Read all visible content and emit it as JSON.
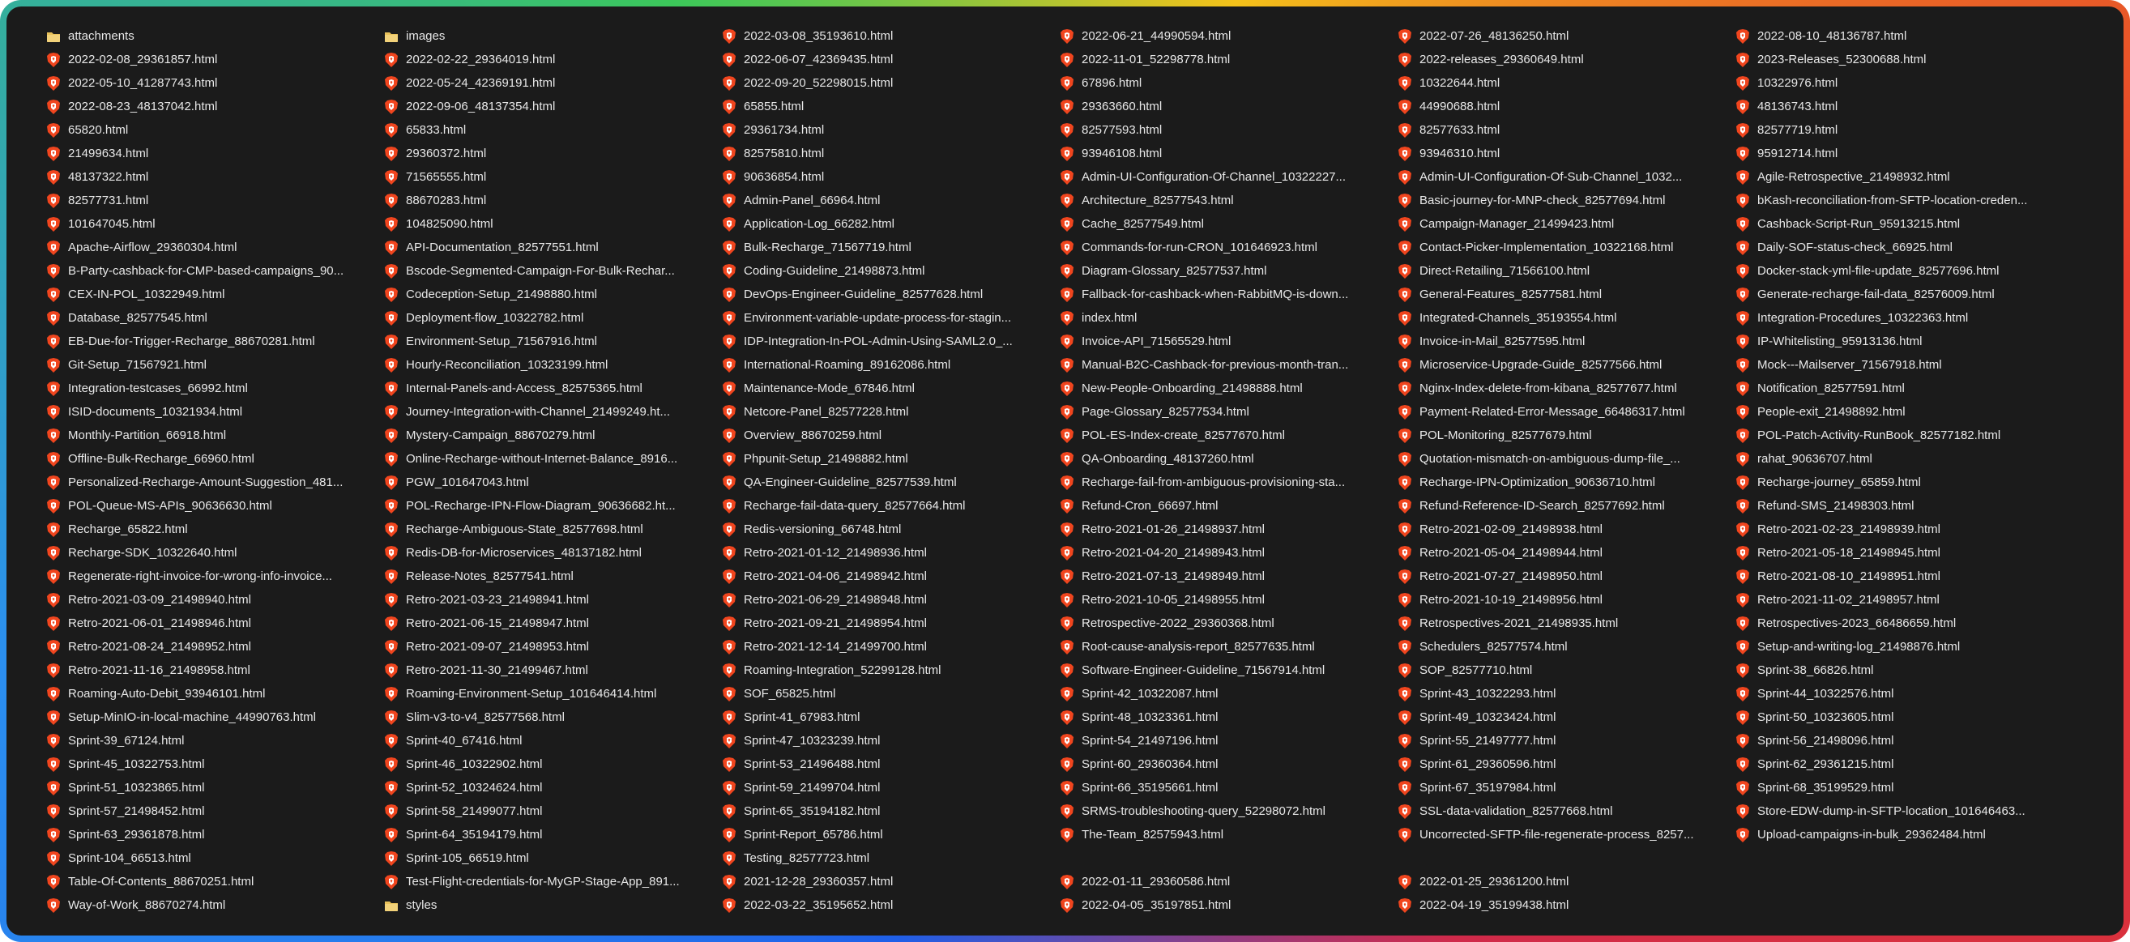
{
  "files": [
    {
      "name": "attachments",
      "type": "folder"
    },
    {
      "name": "2022-02-08_29361857.html",
      "type": "html"
    },
    {
      "name": "2022-05-10_41287743.html",
      "type": "html"
    },
    {
      "name": "2022-08-23_48137042.html",
      "type": "html"
    },
    {
      "name": "65820.html",
      "type": "html"
    },
    {
      "name": "21499634.html",
      "type": "html"
    },
    {
      "name": "48137322.html",
      "type": "html"
    },
    {
      "name": "82577731.html",
      "type": "html"
    },
    {
      "name": "101647045.html",
      "type": "html"
    },
    {
      "name": "Apache-Airflow_29360304.html",
      "type": "html"
    },
    {
      "name": "B-Party-cashback-for-CMP-based-campaigns_90...",
      "type": "html"
    },
    {
      "name": "CEX-IN-POL_10322949.html",
      "type": "html"
    },
    {
      "name": "Database_82577545.html",
      "type": "html"
    },
    {
      "name": "EB-Due-for-Trigger-Recharge_88670281.html",
      "type": "html"
    },
    {
      "name": "Git-Setup_71567921.html",
      "type": "html"
    },
    {
      "name": "Integration-testcases_66992.html",
      "type": "html"
    },
    {
      "name": "ISID-documents_10321934.html",
      "type": "html"
    },
    {
      "name": "Monthly-Partition_66918.html",
      "type": "html"
    },
    {
      "name": "Offline-Bulk-Recharge_66960.html",
      "type": "html"
    },
    {
      "name": "Personalized-Recharge-Amount-Suggestion_481...",
      "type": "html"
    },
    {
      "name": "POL-Queue-MS-APIs_90636630.html",
      "type": "html"
    },
    {
      "name": "Recharge_65822.html",
      "type": "html"
    },
    {
      "name": "Recharge-SDK_10322640.html",
      "type": "html"
    },
    {
      "name": "Regenerate-right-invoice-for-wrong-info-invoice...",
      "type": "html"
    },
    {
      "name": "Retro-2021-03-09_21498940.html",
      "type": "html"
    },
    {
      "name": "Retro-2021-06-01_21498946.html",
      "type": "html"
    },
    {
      "name": "Retro-2021-08-24_21498952.html",
      "type": "html"
    },
    {
      "name": "Retro-2021-11-16_21498958.html",
      "type": "html"
    },
    {
      "name": "Roaming-Auto-Debit_93946101.html",
      "type": "html"
    },
    {
      "name": "Setup-MinIO-in-local-machine_44990763.html",
      "type": "html"
    },
    {
      "name": "Sprint-39_67124.html",
      "type": "html"
    },
    {
      "name": "Sprint-45_10322753.html",
      "type": "html"
    },
    {
      "name": "Sprint-51_10323865.html",
      "type": "html"
    },
    {
      "name": "Sprint-57_21498452.html",
      "type": "html"
    },
    {
      "name": "Sprint-63_29361878.html",
      "type": "html"
    },
    {
      "name": "Sprint-104_66513.html",
      "type": "html"
    },
    {
      "name": "Table-Of-Contents_88670251.html",
      "type": "html"
    },
    {
      "name": "Way-of-Work_88670274.html",
      "type": "html"
    },
    {
      "name": "images",
      "type": "folder"
    },
    {
      "name": "2022-02-22_29364019.html",
      "type": "html"
    },
    {
      "name": "2022-05-24_42369191.html",
      "type": "html"
    },
    {
      "name": "2022-09-06_48137354.html",
      "type": "html"
    },
    {
      "name": "65833.html",
      "type": "html"
    },
    {
      "name": "29360372.html",
      "type": "html"
    },
    {
      "name": "71565555.html",
      "type": "html"
    },
    {
      "name": "88670283.html",
      "type": "html"
    },
    {
      "name": "104825090.html",
      "type": "html"
    },
    {
      "name": "API-Documentation_82577551.html",
      "type": "html"
    },
    {
      "name": "Bscode-Segmented-Campaign-For-Bulk-Rechar...",
      "type": "html"
    },
    {
      "name": "Codeception-Setup_21498880.html",
      "type": "html"
    },
    {
      "name": "Deployment-flow_10322782.html",
      "type": "html"
    },
    {
      "name": "Environment-Setup_71567916.html",
      "type": "html"
    },
    {
      "name": "Hourly-Reconciliation_10323199.html",
      "type": "html"
    },
    {
      "name": "Internal-Panels-and-Access_82575365.html",
      "type": "html"
    },
    {
      "name": "Journey-Integration-with-Channel_21499249.ht...",
      "type": "html"
    },
    {
      "name": "Mystery-Campaign_88670279.html",
      "type": "html"
    },
    {
      "name": "Online-Recharge-without-Internet-Balance_8916...",
      "type": "html"
    },
    {
      "name": "PGW_101647043.html",
      "type": "html"
    },
    {
      "name": "POL-Recharge-IPN-Flow-Diagram_90636682.ht...",
      "type": "html"
    },
    {
      "name": "Recharge-Ambiguous-State_82577698.html",
      "type": "html"
    },
    {
      "name": "Redis-DB-for-Microservices_48137182.html",
      "type": "html"
    },
    {
      "name": "Release-Notes_82577541.html",
      "type": "html"
    },
    {
      "name": "Retro-2021-03-23_21498941.html",
      "type": "html"
    },
    {
      "name": "Retro-2021-06-15_21498947.html",
      "type": "html"
    },
    {
      "name": "Retro-2021-09-07_21498953.html",
      "type": "html"
    },
    {
      "name": "Retro-2021-11-30_21499467.html",
      "type": "html"
    },
    {
      "name": "Roaming-Environment-Setup_101646414.html",
      "type": "html"
    },
    {
      "name": "Slim-v3-to-v4_82577568.html",
      "type": "html"
    },
    {
      "name": "Sprint-40_67416.html",
      "type": "html"
    },
    {
      "name": "Sprint-46_10322902.html",
      "type": "html"
    },
    {
      "name": "Sprint-52_10324624.html",
      "type": "html"
    },
    {
      "name": "Sprint-58_21499077.html",
      "type": "html"
    },
    {
      "name": "Sprint-64_35194179.html",
      "type": "html"
    },
    {
      "name": "Sprint-105_66519.html",
      "type": "html"
    },
    {
      "name": "Test-Flight-credentials-for-MyGP-Stage-App_891...",
      "type": "html"
    },
    {
      "name": "styles",
      "type": "folder"
    },
    {
      "name": "2022-03-08_35193610.html",
      "type": "html"
    },
    {
      "name": "2022-06-07_42369435.html",
      "type": "html"
    },
    {
      "name": "2022-09-20_52298015.html",
      "type": "html"
    },
    {
      "name": "65855.html",
      "type": "html"
    },
    {
      "name": "29361734.html",
      "type": "html"
    },
    {
      "name": "82575810.html",
      "type": "html"
    },
    {
      "name": "90636854.html",
      "type": "html"
    },
    {
      "name": "Admin-Panel_66964.html",
      "type": "html"
    },
    {
      "name": "Application-Log_66282.html",
      "type": "html"
    },
    {
      "name": "Bulk-Recharge_71567719.html",
      "type": "html"
    },
    {
      "name": "Coding-Guideline_21498873.html",
      "type": "html"
    },
    {
      "name": "DevOps-Engineer-Guideline_82577628.html",
      "type": "html"
    },
    {
      "name": "Environment-variable-update-process-for-stagin...",
      "type": "html"
    },
    {
      "name": "IDP-Integration-In-POL-Admin-Using-SAML2.0_...",
      "type": "html"
    },
    {
      "name": "International-Roaming_89162086.html",
      "type": "html"
    },
    {
      "name": "Maintenance-Mode_67846.html",
      "type": "html"
    },
    {
      "name": "Netcore-Panel_82577228.html",
      "type": "html"
    },
    {
      "name": "Overview_88670259.html",
      "type": "html"
    },
    {
      "name": "Phpunit-Setup_21498882.html",
      "type": "html"
    },
    {
      "name": "QA-Engineer-Guideline_82577539.html",
      "type": "html"
    },
    {
      "name": "Recharge-fail-data-query_82577664.html",
      "type": "html"
    },
    {
      "name": "Redis-versioning_66748.html",
      "type": "html"
    },
    {
      "name": "Retro-2021-01-12_21498936.html",
      "type": "html"
    },
    {
      "name": "Retro-2021-04-06_21498942.html",
      "type": "html"
    },
    {
      "name": "Retro-2021-06-29_21498948.html",
      "type": "html"
    },
    {
      "name": "Retro-2021-09-21_21498954.html",
      "type": "html"
    },
    {
      "name": "Retro-2021-12-14_21499700.html",
      "type": "html"
    },
    {
      "name": "Roaming-Integration_52299128.html",
      "type": "html"
    },
    {
      "name": "SOF_65825.html",
      "type": "html"
    },
    {
      "name": "Sprint-41_67983.html",
      "type": "html"
    },
    {
      "name": "Sprint-47_10323239.html",
      "type": "html"
    },
    {
      "name": "Sprint-53_21496488.html",
      "type": "html"
    },
    {
      "name": "Sprint-59_21499704.html",
      "type": "html"
    },
    {
      "name": "Sprint-65_35194182.html",
      "type": "html"
    },
    {
      "name": "Sprint-Report_65786.html",
      "type": "html"
    },
    {
      "name": "Testing_82577723.html",
      "type": "html"
    },
    {
      "name": "2021-12-28_29360357.html",
      "type": "html"
    },
    {
      "name": "2022-03-22_35195652.html",
      "type": "html"
    },
    {
      "name": "2022-06-21_44990594.html",
      "type": "html"
    },
    {
      "name": "2022-11-01_52298778.html",
      "type": "html"
    },
    {
      "name": "67896.html",
      "type": "html"
    },
    {
      "name": "29363660.html",
      "type": "html"
    },
    {
      "name": "82577593.html",
      "type": "html"
    },
    {
      "name": "93946108.html",
      "type": "html"
    },
    {
      "name": "Admin-UI-Configuration-Of-Channel_10322227...",
      "type": "html"
    },
    {
      "name": "Architecture_82577543.html",
      "type": "html"
    },
    {
      "name": "Cache_82577549.html",
      "type": "html"
    },
    {
      "name": "Commands-for-run-CRON_101646923.html",
      "type": "html"
    },
    {
      "name": "Diagram-Glossary_82577537.html",
      "type": "html"
    },
    {
      "name": "Fallback-for-cashback-when-RabbitMQ-is-down...",
      "type": "html"
    },
    {
      "name": "index.html",
      "type": "html"
    },
    {
      "name": "Invoice-API_71565529.html",
      "type": "html"
    },
    {
      "name": "Manual-B2C-Cashback-for-previous-month-tran...",
      "type": "html"
    },
    {
      "name": "New-People-Onboarding_21498888.html",
      "type": "html"
    },
    {
      "name": "Page-Glossary_82577534.html",
      "type": "html"
    },
    {
      "name": "POL-ES-Index-create_82577670.html",
      "type": "html"
    },
    {
      "name": "QA-Onboarding_48137260.html",
      "type": "html"
    },
    {
      "name": "Recharge-fail-from-ambiguous-provisioning-sta...",
      "type": "html"
    },
    {
      "name": "Refund-Cron_66697.html",
      "type": "html"
    },
    {
      "name": "Retro-2021-01-26_21498937.html",
      "type": "html"
    },
    {
      "name": "Retro-2021-04-20_21498943.html",
      "type": "html"
    },
    {
      "name": "Retro-2021-07-13_21498949.html",
      "type": "html"
    },
    {
      "name": "Retro-2021-10-05_21498955.html",
      "type": "html"
    },
    {
      "name": "Retrospective-2022_29360368.html",
      "type": "html"
    },
    {
      "name": "Root-cause-analysis-report_82577635.html",
      "type": "html"
    },
    {
      "name": "Software-Engineer-Guideline_71567914.html",
      "type": "html"
    },
    {
      "name": "Sprint-42_10322087.html",
      "type": "html"
    },
    {
      "name": "Sprint-48_10323361.html",
      "type": "html"
    },
    {
      "name": "Sprint-54_21497196.html",
      "type": "html"
    },
    {
      "name": "Sprint-60_29360364.html",
      "type": "html"
    },
    {
      "name": "Sprint-66_35195661.html",
      "type": "html"
    },
    {
      "name": "SRMS-troubleshooting-query_52298072.html",
      "type": "html"
    },
    {
      "name": "The-Team_82575943.html",
      "type": "html"
    },
    {
      "name": "",
      "type": "empty"
    },
    {
      "name": "2022-01-11_29360586.html",
      "type": "html"
    },
    {
      "name": "2022-04-05_35197851.html",
      "type": "html"
    },
    {
      "name": "2022-07-26_48136250.html",
      "type": "html"
    },
    {
      "name": "2022-releases_29360649.html",
      "type": "html"
    },
    {
      "name": "10322644.html",
      "type": "html"
    },
    {
      "name": "44990688.html",
      "type": "html"
    },
    {
      "name": "82577633.html",
      "type": "html"
    },
    {
      "name": "93946310.html",
      "type": "html"
    },
    {
      "name": "Admin-UI-Configuration-Of-Sub-Channel_1032...",
      "type": "html"
    },
    {
      "name": "Basic-journey-for-MNP-check_82577694.html",
      "type": "html"
    },
    {
      "name": "Campaign-Manager_21499423.html",
      "type": "html"
    },
    {
      "name": "Contact-Picker-Implementation_10322168.html",
      "type": "html"
    },
    {
      "name": "Direct-Retailing_71566100.html",
      "type": "html"
    },
    {
      "name": "General-Features_82577581.html",
      "type": "html"
    },
    {
      "name": "Integrated-Channels_35193554.html",
      "type": "html"
    },
    {
      "name": "Invoice-in-Mail_82577595.html",
      "type": "html"
    },
    {
      "name": "Microservice-Upgrade-Guide_82577566.html",
      "type": "html"
    },
    {
      "name": "Nginx-Index-delete-from-kibana_82577677.html",
      "type": "html"
    },
    {
      "name": "Payment-Related-Error-Message_66486317.html",
      "type": "html"
    },
    {
      "name": "POL-Monitoring_82577679.html",
      "type": "html"
    },
    {
      "name": "Quotation-mismatch-on-ambiguous-dump-file_...",
      "type": "html"
    },
    {
      "name": "Recharge-IPN-Optimization_90636710.html",
      "type": "html"
    },
    {
      "name": "Refund-Reference-ID-Search_82577692.html",
      "type": "html"
    },
    {
      "name": "Retro-2021-02-09_21498938.html",
      "type": "html"
    },
    {
      "name": "Retro-2021-05-04_21498944.html",
      "type": "html"
    },
    {
      "name": "Retro-2021-07-27_21498950.html",
      "type": "html"
    },
    {
      "name": "Retro-2021-10-19_21498956.html",
      "type": "html"
    },
    {
      "name": "Retrospectives-2021_21498935.html",
      "type": "html"
    },
    {
      "name": "Schedulers_82577574.html",
      "type": "html"
    },
    {
      "name": "SOP_82577710.html",
      "type": "html"
    },
    {
      "name": "Sprint-43_10322293.html",
      "type": "html"
    },
    {
      "name": "Sprint-49_10323424.html",
      "type": "html"
    },
    {
      "name": "Sprint-55_21497777.html",
      "type": "html"
    },
    {
      "name": "Sprint-61_29360596.html",
      "type": "html"
    },
    {
      "name": "Sprint-67_35197984.html",
      "type": "html"
    },
    {
      "name": "SSL-data-validation_82577668.html",
      "type": "html"
    },
    {
      "name": "Uncorrected-SFTP-file-regenerate-process_8257...",
      "type": "html"
    },
    {
      "name": "",
      "type": "empty"
    },
    {
      "name": "2022-01-25_29361200.html",
      "type": "html"
    },
    {
      "name": "2022-04-19_35199438.html",
      "type": "html"
    },
    {
      "name": "2022-08-10_48136787.html",
      "type": "html"
    },
    {
      "name": "2023-Releases_52300688.html",
      "type": "html"
    },
    {
      "name": "10322976.html",
      "type": "html"
    },
    {
      "name": "48136743.html",
      "type": "html"
    },
    {
      "name": "82577719.html",
      "type": "html"
    },
    {
      "name": "95912714.html",
      "type": "html"
    },
    {
      "name": "Agile-Retrospective_21498932.html",
      "type": "html"
    },
    {
      "name": "bKash-reconciliation-from-SFTP-location-creden...",
      "type": "html"
    },
    {
      "name": "Cashback-Script-Run_95913215.html",
      "type": "html"
    },
    {
      "name": "Daily-SOF-status-check_66925.html",
      "type": "html"
    },
    {
      "name": "Docker-stack-yml-file-update_82577696.html",
      "type": "html"
    },
    {
      "name": "Generate-recharge-fail-data_82576009.html",
      "type": "html"
    },
    {
      "name": "Integration-Procedures_10322363.html",
      "type": "html"
    },
    {
      "name": "IP-Whitelisting_95913136.html",
      "type": "html"
    },
    {
      "name": "Mock---Mailserver_71567918.html",
      "type": "html"
    },
    {
      "name": "Notification_82577591.html",
      "type": "html"
    },
    {
      "name": "People-exit_21498892.html",
      "type": "html"
    },
    {
      "name": "POL-Patch-Activity-RunBook_82577182.html",
      "type": "html"
    },
    {
      "name": "rahat_90636707.html",
      "type": "html"
    },
    {
      "name": "Recharge-journey_65859.html",
      "type": "html"
    },
    {
      "name": "Refund-SMS_21498303.html",
      "type": "html"
    },
    {
      "name": "Retro-2021-02-23_21498939.html",
      "type": "html"
    },
    {
      "name": "Retro-2021-05-18_21498945.html",
      "type": "html"
    },
    {
      "name": "Retro-2021-08-10_21498951.html",
      "type": "html"
    },
    {
      "name": "Retro-2021-11-02_21498957.html",
      "type": "html"
    },
    {
      "name": "Retrospectives-2023_66486659.html",
      "type": "html"
    },
    {
      "name": "Setup-and-writing-log_21498876.html",
      "type": "html"
    },
    {
      "name": "Sprint-38_66826.html",
      "type": "html"
    },
    {
      "name": "Sprint-44_10322576.html",
      "type": "html"
    },
    {
      "name": "Sprint-50_10323605.html",
      "type": "html"
    },
    {
      "name": "Sprint-56_21498096.html",
      "type": "html"
    },
    {
      "name": "Sprint-62_29361215.html",
      "type": "html"
    },
    {
      "name": "Sprint-68_35199529.html",
      "type": "html"
    },
    {
      "name": "Store-EDW-dump-in-SFTP-location_101646463...",
      "type": "html"
    },
    {
      "name": "Upload-campaigns-in-bulk_29362484.html",
      "type": "html"
    }
  ],
  "icons": {
    "folder": "folder-icon",
    "html": "brave-html-file-icon"
  },
  "colors": {
    "background": "#1b1b1b",
    "text": "#e8e8e8",
    "folder": "#e8c15a",
    "html_icon": "#f0451e"
  }
}
